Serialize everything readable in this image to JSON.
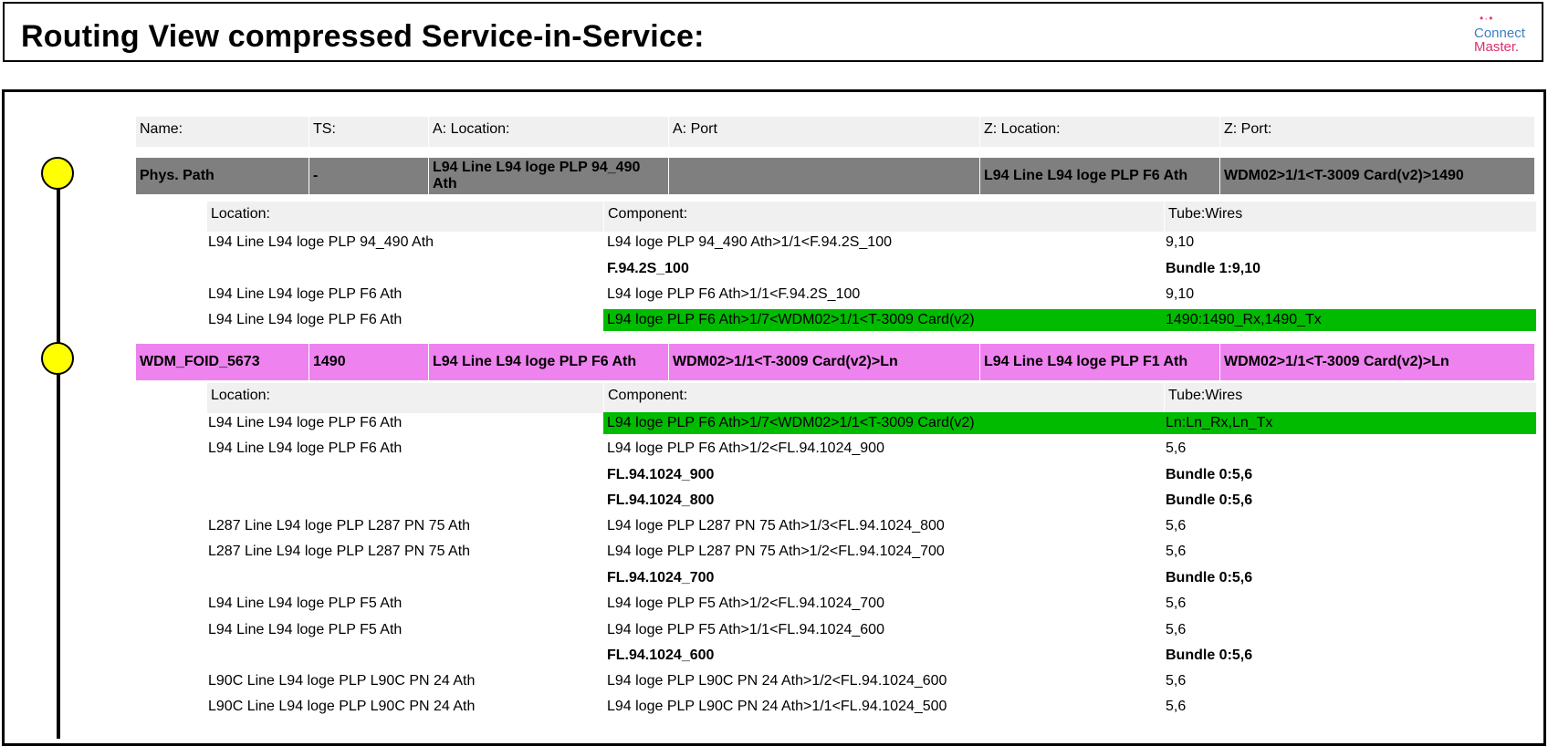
{
  "title": "Routing View compressed Service-in-Service:",
  "logo": {
    "dots": "•·•",
    "line1": "Connect",
    "line2": "Master."
  },
  "colors": {
    "phys_row": "#7f7f7f",
    "wdm_row": "#ee82ee",
    "green": "#00bb00",
    "node": "#ffff00"
  },
  "main_header": [
    "Name:",
    "TS:",
    "A: Location:",
    "A: Port",
    "Z: Location:",
    "Z: Port:"
  ],
  "sub_header": [
    "Location:",
    "Component:",
    "Tube:Wires"
  ],
  "services": [
    {
      "name": "Phys. Path",
      "ts": "-",
      "a_location": "L94 Line L94 loge PLP 94_490 Ath",
      "a_port": "",
      "z_location": "L94 Line L94 loge PLP F6 Ath",
      "z_port": "WDM02>1/1<T-3009 Card(v2)>1490",
      "details": [
        {
          "location": "L94 Line L94 loge PLP 94_490 Ath",
          "component": "L94 loge PLP 94_490 Ath>1/1<F.94.2S_100",
          "tube": "9,10"
        },
        {
          "location": "",
          "component": "F.94.2S_100",
          "tube": "Bundle 1:9,10"
        },
        {
          "location": "L94 Line L94 loge PLP F6 Ath",
          "component": "L94 loge PLP F6 Ath>1/1<F.94.2S_100",
          "tube": "9,10"
        },
        {
          "location": "L94 Line L94 loge PLP F6 Ath",
          "component": "L94 loge PLP F6 Ath>1/7<WDM02>1/1<T-3009 Card(v2)",
          "tube": "1490:1490_Rx,1490_Tx"
        }
      ]
    },
    {
      "name": "WDM_FOID_5673",
      "ts": "1490",
      "a_location": "L94 Line L94 loge PLP F6 Ath",
      "a_port": "WDM02>1/1<T-3009 Card(v2)>Ln",
      "z_location": "L94 Line L94 loge PLP F1 Ath",
      "z_port": "WDM02>1/1<T-3009 Card(v2)>Ln",
      "details": [
        {
          "location": "L94 Line L94 loge PLP F6 Ath",
          "component": "L94 loge PLP F6 Ath>1/7<WDM02>1/1<T-3009 Card(v2)",
          "tube": "Ln:Ln_Rx,Ln_Tx"
        },
        {
          "location": "L94 Line L94 loge PLP F6 Ath",
          "component": "L94 loge PLP F6 Ath>1/2<FL.94.1024_900",
          "tube": "5,6"
        },
        {
          "location": "",
          "component": "FL.94.1024_900",
          "tube": "Bundle 0:5,6"
        },
        {
          "location": "",
          "component": "FL.94.1024_800",
          "tube": "Bundle 0:5,6"
        },
        {
          "location": "L287 Line L94 loge PLP L287 PN 75 Ath",
          "component": "L94 loge PLP L287 PN 75 Ath>1/3<FL.94.1024_800",
          "tube": "5,6"
        },
        {
          "location": "L287 Line L94 loge PLP L287 PN 75 Ath",
          "component": "L94 loge PLP L287 PN 75 Ath>1/2<FL.94.1024_700",
          "tube": "5,6"
        },
        {
          "location": "",
          "component": "FL.94.1024_700",
          "tube": "Bundle 0:5,6"
        },
        {
          "location": "L94 Line L94 loge PLP F5 Ath",
          "component": "L94 loge PLP F5 Ath>1/2<FL.94.1024_700",
          "tube": "5,6"
        },
        {
          "location": "L94 Line L94 loge PLP F5 Ath",
          "component": "L94 loge PLP F5 Ath>1/1<FL.94.1024_600",
          "tube": "5,6"
        },
        {
          "location": "",
          "component": "FL.94.1024_600",
          "tube": "Bundle 0:5,6"
        },
        {
          "location": "L90C Line L94 loge PLP L90C PN 24 Ath",
          "component": "L94 loge PLP L90C PN 24 Ath>1/2<FL.94.1024_600",
          "tube": "5,6"
        },
        {
          "location": "L90C Line L94 loge PLP L90C PN 24 Ath",
          "component": "L94 loge PLP L90C PN 24 Ath>1/1<FL.94.1024_500",
          "tube": "5,6"
        }
      ]
    }
  ]
}
